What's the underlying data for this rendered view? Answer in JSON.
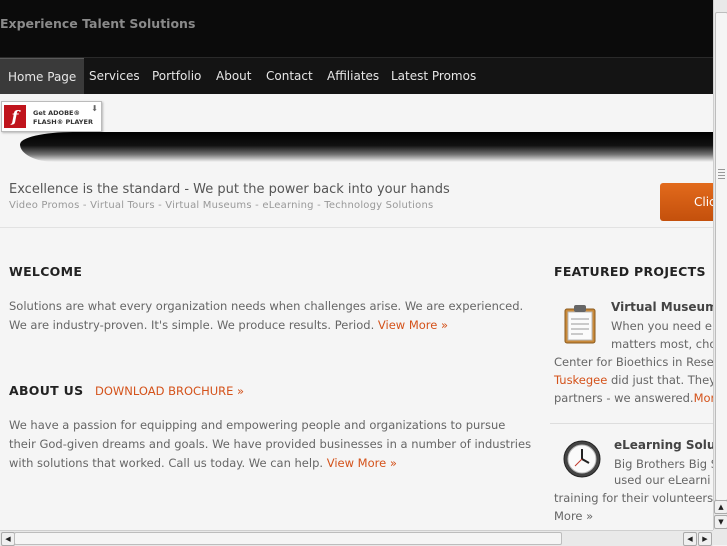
{
  "header": {
    "site_title": "Experience Talent Solutions"
  },
  "nav": [
    {
      "label": "Home Page"
    },
    {
      "label": "Services"
    },
    {
      "label": "Portfolio"
    },
    {
      "label": "About"
    },
    {
      "label": "Contact"
    },
    {
      "label": "Affiliates"
    },
    {
      "label": "Latest Promos"
    }
  ],
  "flash_badge": {
    "logo": "f",
    "line1": "Get ADOBE®",
    "line2": "FLASH® PLAYER"
  },
  "banner": {
    "tagline": "Excellence is the standard - We put the power back into your hands",
    "subtagline": "Video Promos - Virtual Tours - Virtual Museums - eLearning - Technology Solutions",
    "cta_label": "Clic"
  },
  "welcome": {
    "heading": "WELCOME",
    "line1": "Solutions are what every organization needs when challenges arise. We are experienced.",
    "line2": "We are industry-proven. It's simple. We produce results. Period.",
    "more": "View More »"
  },
  "about": {
    "heading": "ABOUT US",
    "download": "DOWNLOAD BROCHURE »",
    "line1": "We have a passion for equipping and empowering people and organizations to pursue",
    "line2": "their God-given dreams and goals. We have provided businesses in a number of industries",
    "line3": "with solutions that worked. Call us today. We can help.",
    "more": "View More »"
  },
  "featured": {
    "heading": "FEATURED PROJECTS",
    "p1": {
      "title": "Virtual Museum",
      "l1": "When you need e",
      "l2": "matters most, cho",
      "l3": "Center for Bioethics in Rese",
      "l4a": "Tuskegee",
      "l4b": " did just that. They",
      "l5": "partners - we answered.",
      "more": "Mor"
    },
    "p2": {
      "title": "eLearning Solut",
      "l1": "Big Brothers Big S",
      "l2": "used our eLearni",
      "l3": "training for their volunteers.",
      "more": "More »"
    }
  },
  "colors": {
    "accent": "#d4521a",
    "cta": "#d35f14",
    "nav_bg": "#141414"
  }
}
